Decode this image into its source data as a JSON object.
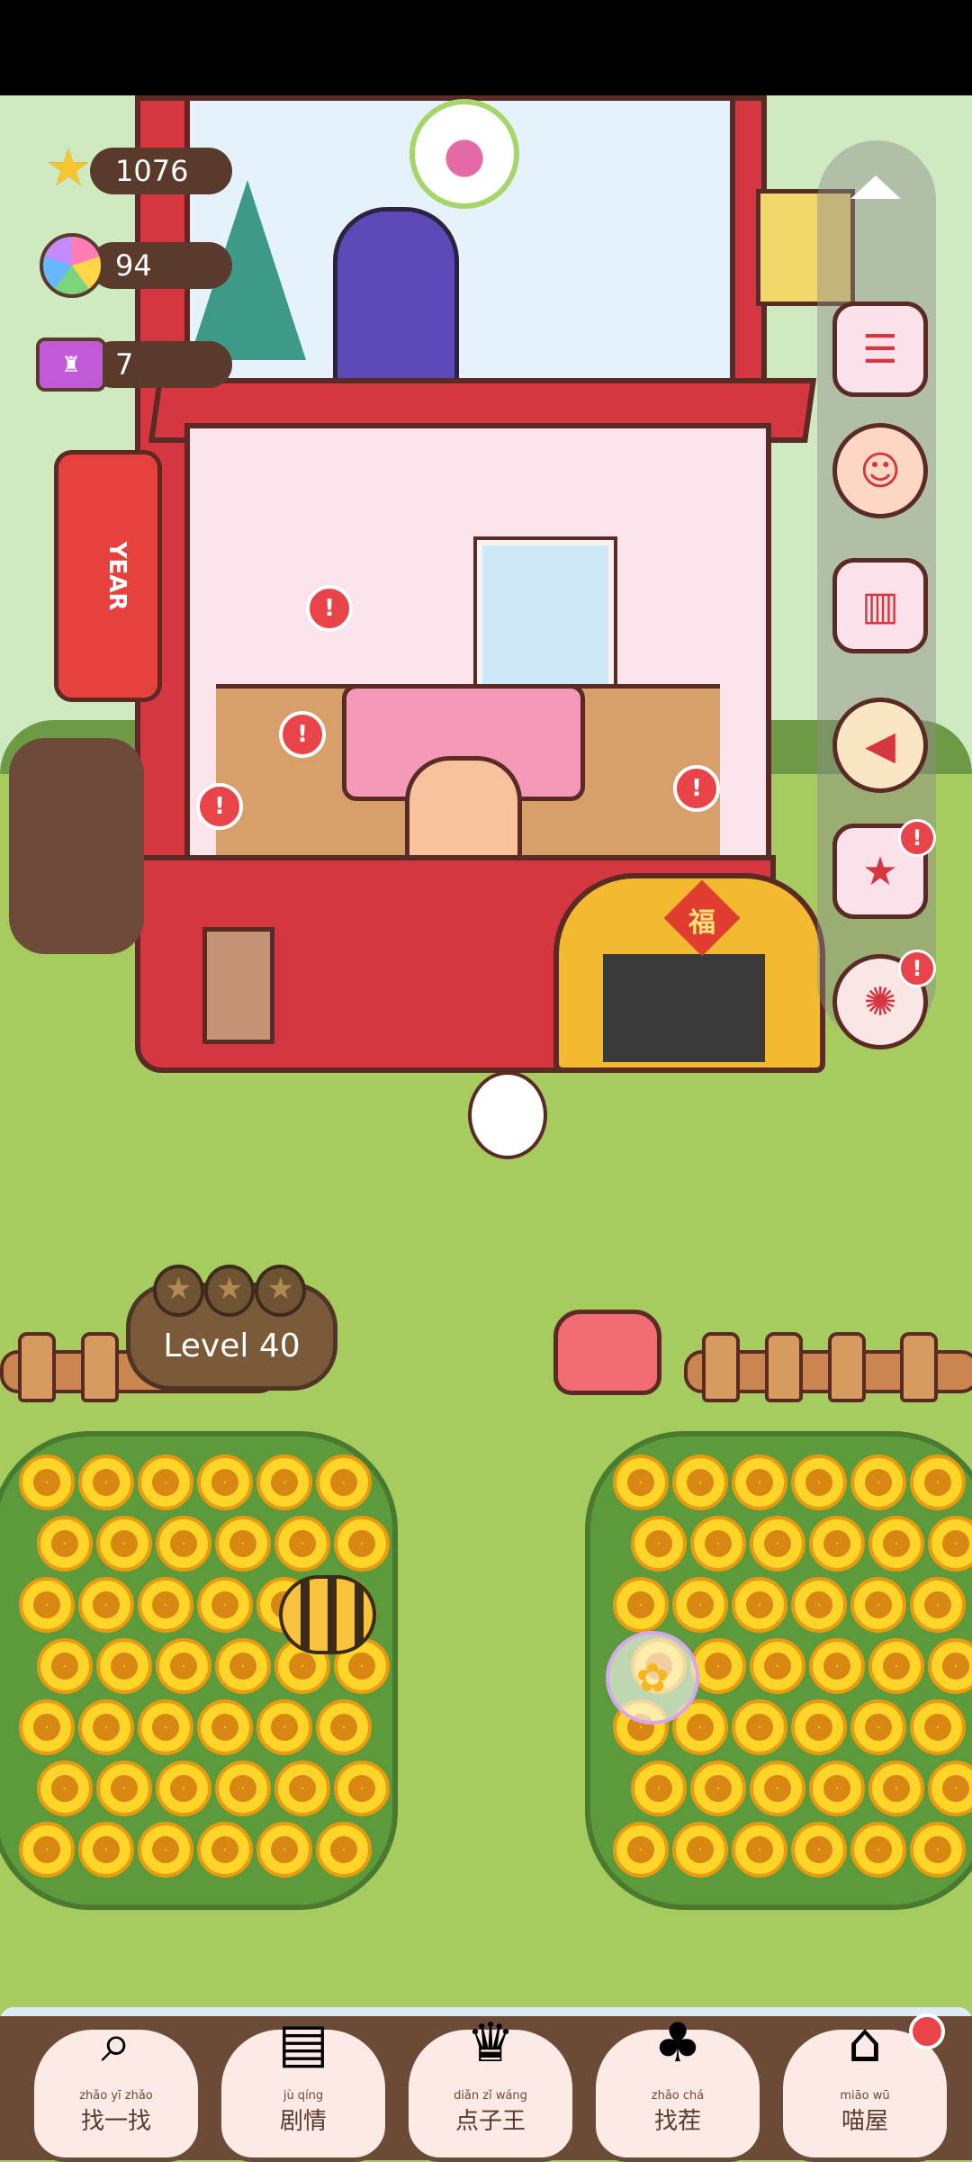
{
  "resources": {
    "stars": "1076",
    "flowers": "94",
    "tickets": "7"
  },
  "level": {
    "label": "Level 40",
    "stars_earned": 0,
    "stars_total": 3
  },
  "decor": {
    "gate_character": "福",
    "lion_sign_text": "YEAR"
  },
  "side_menu": {
    "alert_mark": "!"
  },
  "bottom_nav": [
    {
      "pinyin": "zhǎo yī zhǎo",
      "label": "找一找",
      "icon": "magnifier-icon"
    },
    {
      "pinyin": "jù qíng",
      "label": "剧情",
      "icon": "book-icon"
    },
    {
      "pinyin": "diǎn zǐ wáng",
      "label": "点子王",
      "icon": "lightbulb-icon"
    },
    {
      "pinyin": "zhǎo chá",
      "label": "找茬",
      "icon": "potted-plants-icon"
    },
    {
      "pinyin": "miāo wū",
      "label": "喵屋",
      "icon": "house-icon"
    }
  ],
  "colors": {
    "accent_red": "#d6363f",
    "grass": "#a6cb5f",
    "sunflower": "#ffd52a"
  }
}
